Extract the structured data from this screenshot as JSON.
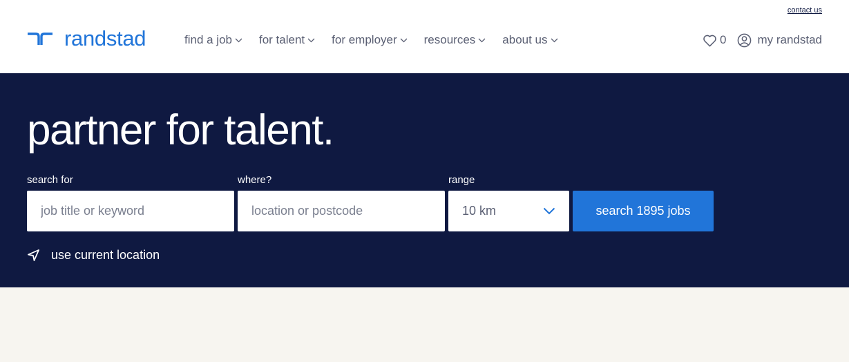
{
  "header": {
    "contact_link": "contact us",
    "logo_text": "randstad",
    "nav": [
      {
        "label": "find a job"
      },
      {
        "label": "for talent"
      },
      {
        "label": "for employer"
      },
      {
        "label": "resources"
      },
      {
        "label": "about us"
      }
    ],
    "favorites_count": "0",
    "account_label": "my randstad"
  },
  "hero": {
    "title": "partner for talent.",
    "search_label": "search for",
    "search_placeholder": "job title or keyword",
    "where_label": "where?",
    "where_placeholder": "location or postcode",
    "range_label": "range",
    "range_value": "10 km",
    "search_button": "search 1895 jobs",
    "current_location": "use current location"
  },
  "colors": {
    "brand_blue": "#2175d9",
    "navy": "#0f1941",
    "page_bg": "#f7f5f0"
  },
  "icons": [
    "randstad-logo-icon",
    "chevron-down-icon",
    "heart-icon",
    "user-circle-icon",
    "navigation-arrow-icon"
  ]
}
